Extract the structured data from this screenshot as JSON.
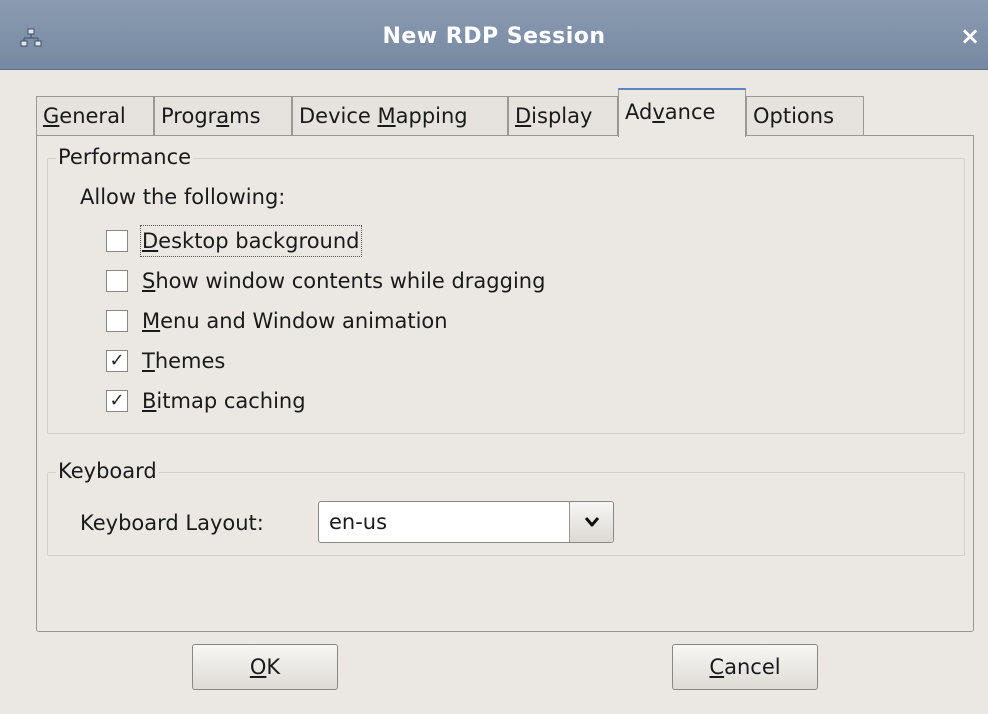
{
  "window": {
    "title": "New RDP Session",
    "icon": "network-icon",
    "close_icon": "close-icon",
    "close_glyph": "×"
  },
  "tabs": [
    {
      "label": "General",
      "mnemonic": "G",
      "active": false
    },
    {
      "label": "Programs",
      "mnemonic": "a",
      "active": false
    },
    {
      "label": "Device Mapping",
      "mnemonic": "M",
      "active": false
    },
    {
      "label": "Display",
      "mnemonic": "D",
      "active": false
    },
    {
      "label": "Advance",
      "mnemonic": "v",
      "active": true
    },
    {
      "label": "Options",
      "mnemonic": "",
      "active": false
    }
  ],
  "performance": {
    "legend": "Performance",
    "allow_label": "Allow the following:",
    "options": [
      {
        "label": "Desktop background",
        "mnemonic": "D",
        "checked": false,
        "focused": true
      },
      {
        "label": "Show window contents while dragging",
        "mnemonic": "S",
        "checked": false,
        "focused": false
      },
      {
        "label": "Menu and Window animation",
        "mnemonic": "M",
        "checked": false,
        "focused": false
      },
      {
        "label": "Themes",
        "mnemonic": "T",
        "checked": true,
        "focused": false
      },
      {
        "label": "Bitmap caching",
        "mnemonic": "B",
        "checked": true,
        "focused": false
      }
    ]
  },
  "keyboard": {
    "legend": "Keyboard",
    "layout_label": "Keyboard Layout:",
    "layout_value": "en-us"
  },
  "buttons": {
    "ok": {
      "label": "OK",
      "mnemonic": "O"
    },
    "cancel": {
      "label": "Cancel",
      "mnemonic": "C"
    }
  },
  "colors": {
    "titlebar": "#7f91a9",
    "active_tab_accent": "#5d87c2",
    "window_bg": "#ebe8e4"
  }
}
